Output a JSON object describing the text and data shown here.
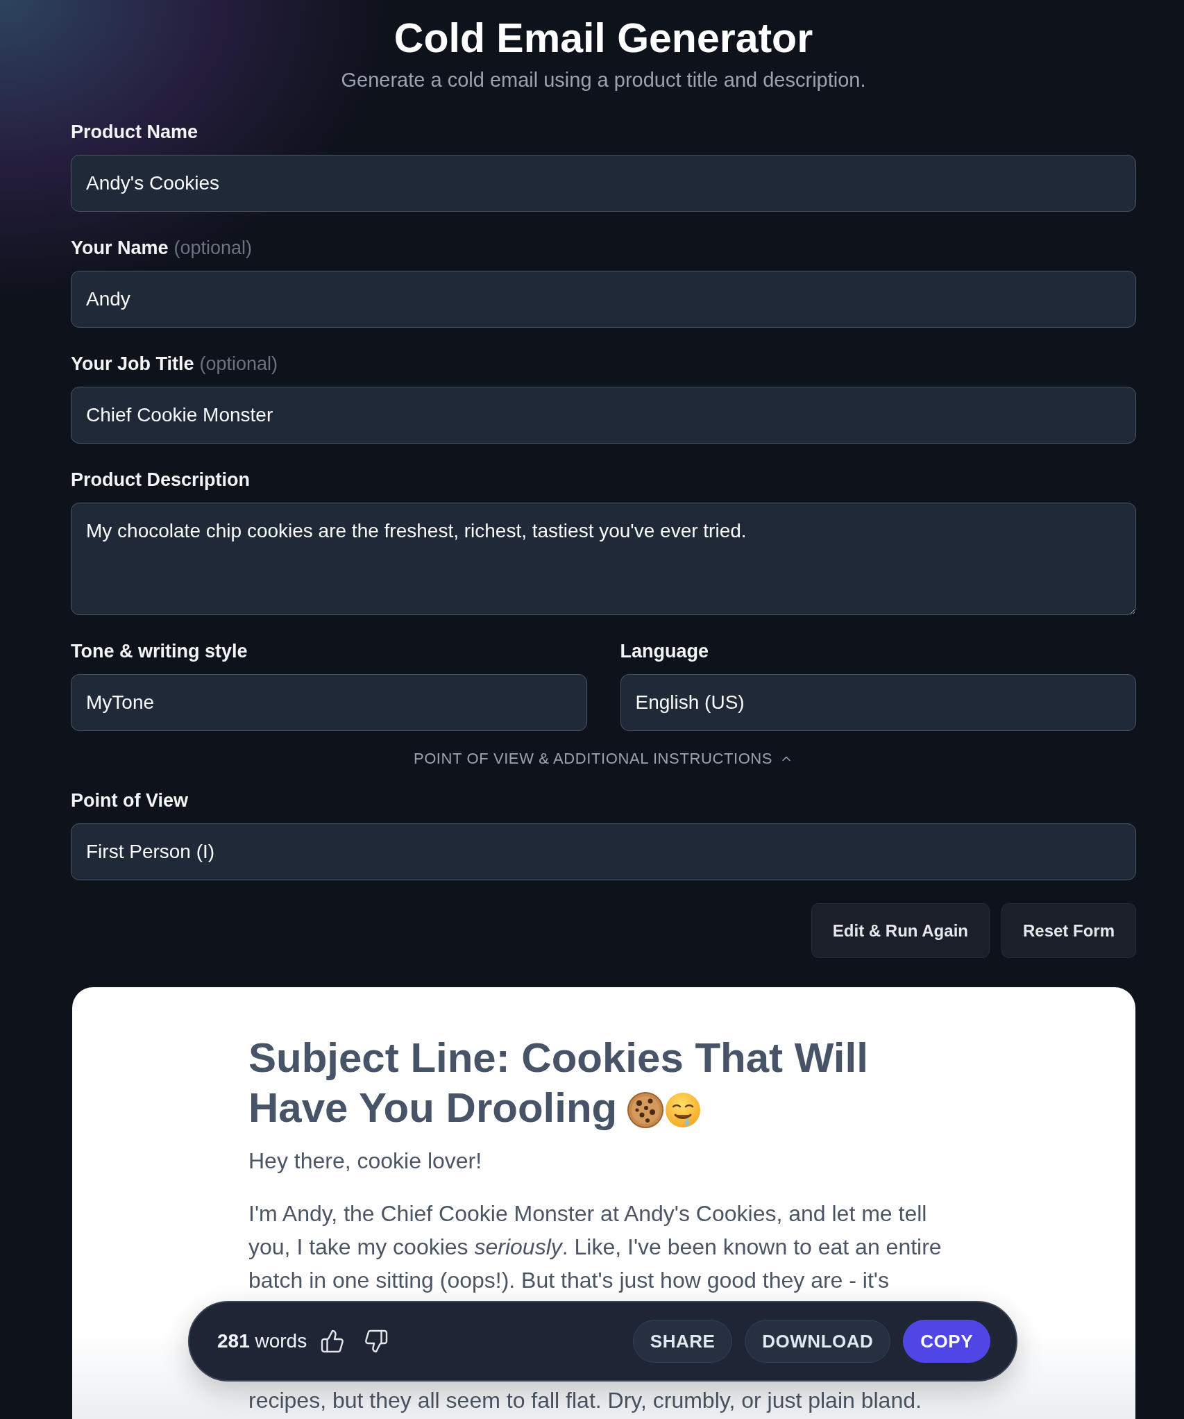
{
  "header": {
    "title": "Cold Email Generator",
    "subtitle": "Generate a cold email using a product title and description."
  },
  "fields": [
    {
      "kind": "line",
      "label": "Product Name",
      "value": "Andy's Cookies"
    },
    {
      "kind": "line",
      "label": "Your Name",
      "note": "(optional)",
      "value": "Andy"
    },
    {
      "kind": "line",
      "label": "Your Job Title",
      "note": "(optional)",
      "value": "Chief Cookie Monster"
    },
    {
      "kind": "area",
      "label": "Product Description",
      "value": "My chocolate chip cookies are the freshest, richest, tastiest you've ever tried."
    }
  ],
  "field_pair": [
    {
      "label": "Tone & writing style",
      "value": "MyTone"
    },
    {
      "label": "Language",
      "value": "English (US)"
    }
  ],
  "more_options": {
    "label": "POINT OF VIEW & ADDITIONAL INSTRUCTIONS",
    "expanded": true,
    "fields": [
      {
        "label": "Point of View",
        "value": "First Person (I)"
      }
    ]
  },
  "actions": [
    {
      "label": "Edit & Run Again"
    },
    {
      "label": "Reset Form"
    }
  ],
  "email": {
    "subject_lines": [
      "Subject Line: Cookies That Will",
      "Have You Drooling"
    ],
    "paragraphs": [
      "Hey there, cookie lover!",
      "I'm Andy, the Chief Cookie Monster at Andy's Cookies, and let me tell you, I take my cookies *seriously*. Like, I've been known to eat an entire batch in one sitting (oops!). But that's just how good they are - it's",
      "recipes, but they all seem to fall flat. Dry, crumbly, or just plain bland."
    ]
  },
  "toolbar": {
    "word_count": "**281** words",
    "buttons": [
      {
        "label": "SHARE",
        "kind": "secondary"
      },
      {
        "label": "DOWNLOAD",
        "kind": "secondary"
      },
      {
        "label": "COPY",
        "kind": "primary"
      }
    ]
  }
}
